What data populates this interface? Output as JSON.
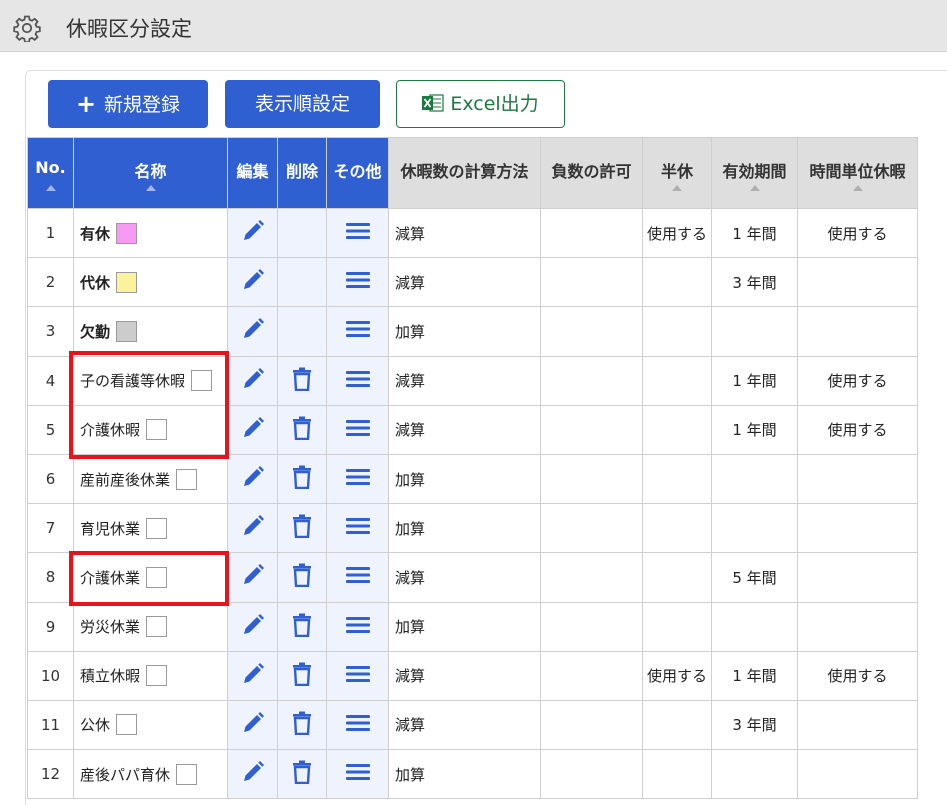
{
  "header": {
    "title": "休暇区分設定",
    "icon": "gear-icon"
  },
  "toolbar": {
    "new_label": "新規登録",
    "order_label": "表示順設定",
    "excel_label": "Excel出力"
  },
  "colors": {
    "accent": "#2f5fd1",
    "excel_green": "#1d7a3f",
    "highlight": "#e8141c"
  },
  "table": {
    "headers": {
      "no": "No.",
      "name": "名称",
      "edit": "編集",
      "delete": "削除",
      "other": "その他",
      "calc": "休暇数の計算方法",
      "negative": "負数の許可",
      "half": "半休",
      "period": "有効期間",
      "hourly": "時間単位休暇"
    },
    "rows": [
      {
        "no": "1",
        "name": "有休",
        "bold": true,
        "color": "#f79af3",
        "deletable": false,
        "calc": "減算",
        "negative": "",
        "half": "使用する",
        "period": "1 年間",
        "hourly": "使用する"
      },
      {
        "no": "2",
        "name": "代休",
        "bold": true,
        "color": "#fbf39b",
        "deletable": false,
        "calc": "減算",
        "negative": "",
        "half": "",
        "period": "3 年間",
        "hourly": ""
      },
      {
        "no": "3",
        "name": "欠勤",
        "bold": true,
        "color": "#cccccc",
        "deletable": false,
        "calc": "加算",
        "negative": "",
        "half": "",
        "period": "",
        "hourly": ""
      },
      {
        "no": "4",
        "name": "子の看護等休暇",
        "bold": false,
        "color": "#ffffff",
        "deletable": true,
        "calc": "減算",
        "negative": "",
        "half": "",
        "period": "1 年間",
        "hourly": "使用する"
      },
      {
        "no": "5",
        "name": "介護休暇",
        "bold": false,
        "color": "#ffffff",
        "deletable": true,
        "calc": "減算",
        "negative": "",
        "half": "",
        "period": "1 年間",
        "hourly": "使用する"
      },
      {
        "no": "6",
        "name": "産前産後休業",
        "bold": false,
        "color": "#ffffff",
        "deletable": true,
        "calc": "加算",
        "negative": "",
        "half": "",
        "period": "",
        "hourly": ""
      },
      {
        "no": "7",
        "name": "育児休業",
        "bold": false,
        "color": "#ffffff",
        "deletable": true,
        "calc": "加算",
        "negative": "",
        "half": "",
        "period": "",
        "hourly": ""
      },
      {
        "no": "8",
        "name": "介護休業",
        "bold": false,
        "color": "#ffffff",
        "deletable": true,
        "calc": "減算",
        "negative": "",
        "half": "",
        "period": "5 年間",
        "hourly": ""
      },
      {
        "no": "9",
        "name": "労災休業",
        "bold": false,
        "color": "#ffffff",
        "deletable": true,
        "calc": "加算",
        "negative": "",
        "half": "",
        "period": "",
        "hourly": ""
      },
      {
        "no": "10",
        "name": "積立休暇",
        "bold": false,
        "color": "#ffffff",
        "deletable": true,
        "calc": "減算",
        "negative": "",
        "half": "使用する",
        "period": "1 年間",
        "hourly": "使用する"
      },
      {
        "no": "11",
        "name": "公休",
        "bold": false,
        "color": "#ffffff",
        "deletable": true,
        "calc": "減算",
        "negative": "",
        "half": "",
        "period": "3 年間",
        "hourly": ""
      },
      {
        "no": "12",
        "name": "産後パパ育休",
        "bold": false,
        "color": "#ffffff",
        "deletable": true,
        "calc": "加算",
        "negative": "",
        "half": "",
        "period": "",
        "hourly": ""
      }
    ]
  }
}
